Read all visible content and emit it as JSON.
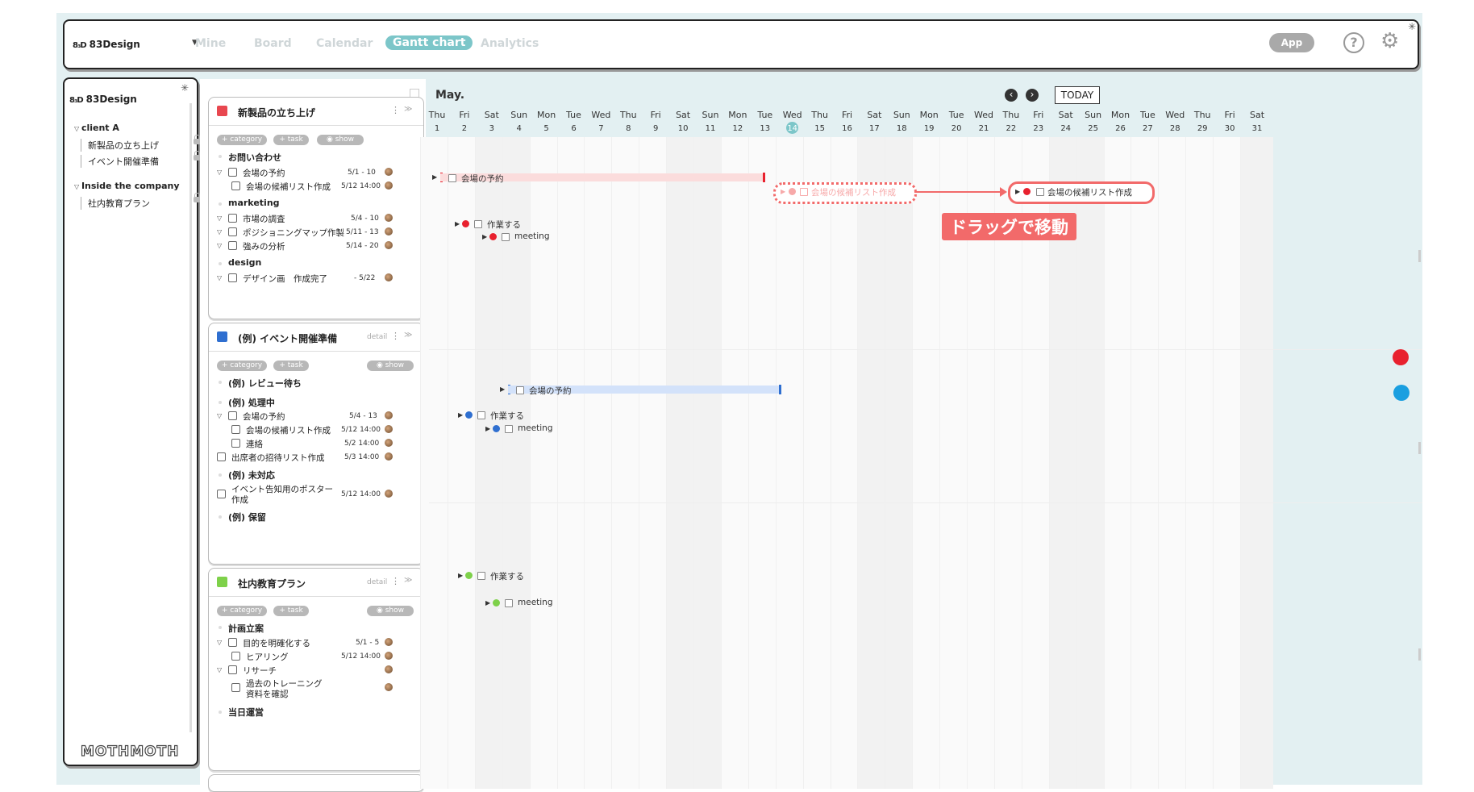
{
  "workspace": {
    "logo_mark": "8₃D",
    "name": "83Design"
  },
  "nav": {
    "tabs": [
      "Mine",
      "Board",
      "Calendar",
      "Gantt chart",
      "Analytics"
    ],
    "active": "Gantt chart"
  },
  "toolbar": {
    "app_label": "App",
    "help_label": "?"
  },
  "sidebar": {
    "title": "83Design",
    "groups": [
      {
        "label": "client A",
        "items": [
          "新製品の立ち上げ",
          "イベント開催準備"
        ]
      },
      {
        "label": "Inside the company",
        "items": [
          "社内教育プラン"
        ]
      }
    ],
    "brand": "MOTHMOTH"
  },
  "pills": {
    "category": "+ category",
    "task": "+ task",
    "show": "show"
  },
  "detail_label": "detail",
  "projects": [
    {
      "title": "新製品の立ち上げ",
      "color": "#e8474f",
      "groups": [
        {
          "label": "お問い合わせ",
          "tasks": [
            {
              "label": "会場の予約",
              "date": "5/1 - 10"
            },
            {
              "label": "会場の候補リスト作成",
              "date": "5/12 14:00"
            }
          ]
        },
        {
          "label": "marketing",
          "tasks": [
            {
              "label": "市場の調査",
              "date": "5/4 - 10"
            },
            {
              "label": "ポジショニングマップ作製",
              "date": "5/11 - 13"
            },
            {
              "label": "強みの分析",
              "date": "5/14 - 20"
            }
          ]
        },
        {
          "label": "design",
          "tasks": [
            {
              "label": "デザイン画　作成完了",
              "date": "- 5/22"
            }
          ]
        }
      ]
    },
    {
      "title": "(例) イベント開催準備",
      "color": "#2f6fd0",
      "groups": [
        {
          "label": "(例) レビュー待ち",
          "tasks": []
        },
        {
          "label": "(例) 処理中",
          "tasks": [
            {
              "label": "会場の予約",
              "date": "5/4 - 13"
            },
            {
              "label": "会場の候補リスト作成",
              "date": "5/12 14:00"
            },
            {
              "label": "連絡",
              "date": "5/2 14:00"
            },
            {
              "label": "出席者の招待リスト作成",
              "date": "5/3 14:00"
            }
          ]
        },
        {
          "label": "(例) 未対応",
          "tasks": [
            {
              "label": "イベント告知用のポスター",
              "label2": "作成",
              "date": "5/12 14:00"
            }
          ]
        },
        {
          "label": "(例) 保留",
          "tasks": []
        }
      ]
    },
    {
      "title": "社内教育プラン",
      "color": "#7ed14a",
      "groups": [
        {
          "label": "計画立案",
          "tasks": [
            {
              "label": "目的を明確化する",
              "date": "5/1 - 5"
            },
            {
              "label": "ヒアリング",
              "date": "5/12 14:00"
            },
            {
              "label": "リサーチ",
              "date": ""
            },
            {
              "label": "過去のトレーニング",
              "label2": "資料を確認",
              "date": ""
            }
          ]
        },
        {
          "label": "当日運営",
          "tasks": []
        }
      ]
    }
  ],
  "gantt": {
    "month": "May.",
    "today_label": "TODAY",
    "today": 14,
    "days": [
      {
        "d": "Thu",
        "n": 1
      },
      {
        "d": "Fri",
        "n": 2
      },
      {
        "d": "Sat",
        "n": 3
      },
      {
        "d": "Sun",
        "n": 4
      },
      {
        "d": "Mon",
        "n": 5
      },
      {
        "d": "Tue",
        "n": 6
      },
      {
        "d": "Wed",
        "n": 7
      },
      {
        "d": "Thu",
        "n": 8
      },
      {
        "d": "Fri",
        "n": 9
      },
      {
        "d": "Sat",
        "n": 10
      },
      {
        "d": "Sun",
        "n": 11
      },
      {
        "d": "Mon",
        "n": 12
      },
      {
        "d": "Tue",
        "n": 13
      },
      {
        "d": "Wed",
        "n": 14
      },
      {
        "d": "Thu",
        "n": 15
      },
      {
        "d": "Fri",
        "n": 16
      },
      {
        "d": "Sat",
        "n": 17
      },
      {
        "d": "Sun",
        "n": 18
      },
      {
        "d": "Mon",
        "n": 19
      },
      {
        "d": "Tue",
        "n": 20
      },
      {
        "d": "Wed",
        "n": 21
      },
      {
        "d": "Thu",
        "n": 22
      },
      {
        "d": "Fri",
        "n": 23
      },
      {
        "d": "Sat",
        "n": 24
      },
      {
        "d": "Sun",
        "n": 25
      },
      {
        "d": "Mon",
        "n": 26
      },
      {
        "d": "Tue",
        "n": 27
      },
      {
        "d": "Wed",
        "n": 28
      },
      {
        "d": "Thu",
        "n": 29
      },
      {
        "d": "Fri",
        "n": 30
      },
      {
        "d": "Sat",
        "n": 31
      }
    ],
    "items": {
      "venue_red": "会場の予約",
      "candidate_ghost": "会場の候補リスト作成",
      "candidate_moved": "会場の候補リスト作成",
      "work": "作業する",
      "meeting": "meeting",
      "venue_blue": "会場の予約"
    },
    "drag_label": "ドラッグで移動",
    "colors": {
      "red": "#e8212e",
      "blue": "#2f6fd0",
      "green": "#7ed14a",
      "accent": "#7cc6c9",
      "drag": "#f26a6a"
    }
  }
}
